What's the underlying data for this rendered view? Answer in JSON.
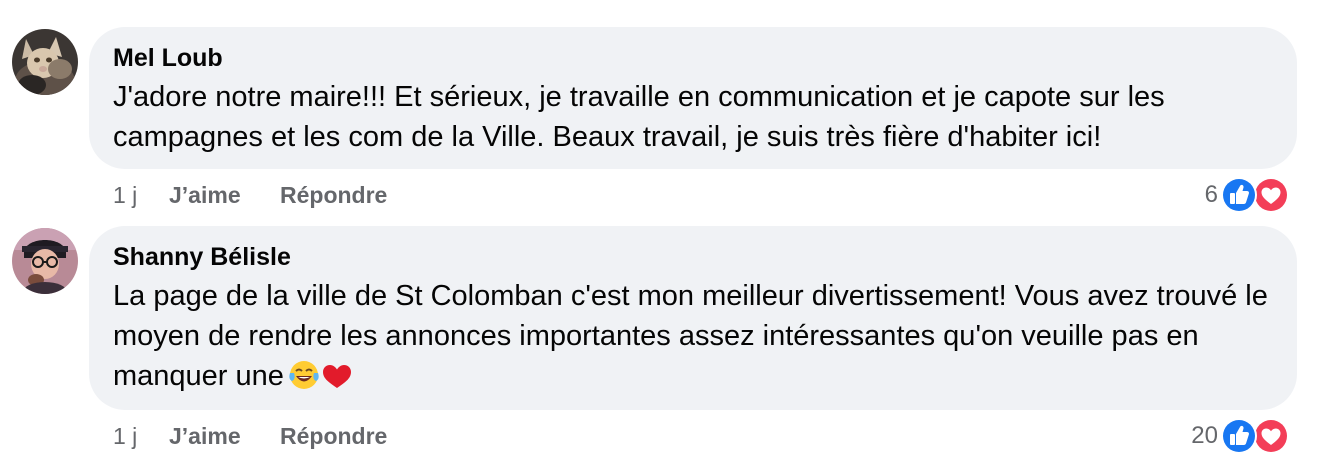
{
  "comments": [
    {
      "author": "Mel Loub",
      "text": "J'adore notre maire!!! Et sérieux, je travaille en communication et je capote sur les campagnes et les com de la Ville. Beaux travail, je suis très fière d'habiter ici!",
      "time": "1 j",
      "like_label": "J’aime",
      "reply_label": "Répondre",
      "reaction_count": "6",
      "reactions": [
        "like-icon",
        "love-icon"
      ]
    },
    {
      "author": "Shanny Bélisle",
      "text": "La page de la ville de St Colomban c'est mon meilleur divertissement! Vous avez trouvé le moyen de rendre les annonces importantes assez intéressantes qu'on veuille pas en manquer une",
      "emojis": [
        "tears-of-joy-emoji",
        "red-heart-emoji"
      ],
      "time": "1 j",
      "like_label": "J’aime",
      "reply_label": "Répondre",
      "reaction_count": "20",
      "reactions": [
        "like-icon",
        "love-icon"
      ]
    }
  ],
  "colors": {
    "bubble_bg": "#f0f2f5",
    "secondary_text": "#65676b",
    "like_blue": "#1877f2",
    "love_red": "#f33e58"
  }
}
